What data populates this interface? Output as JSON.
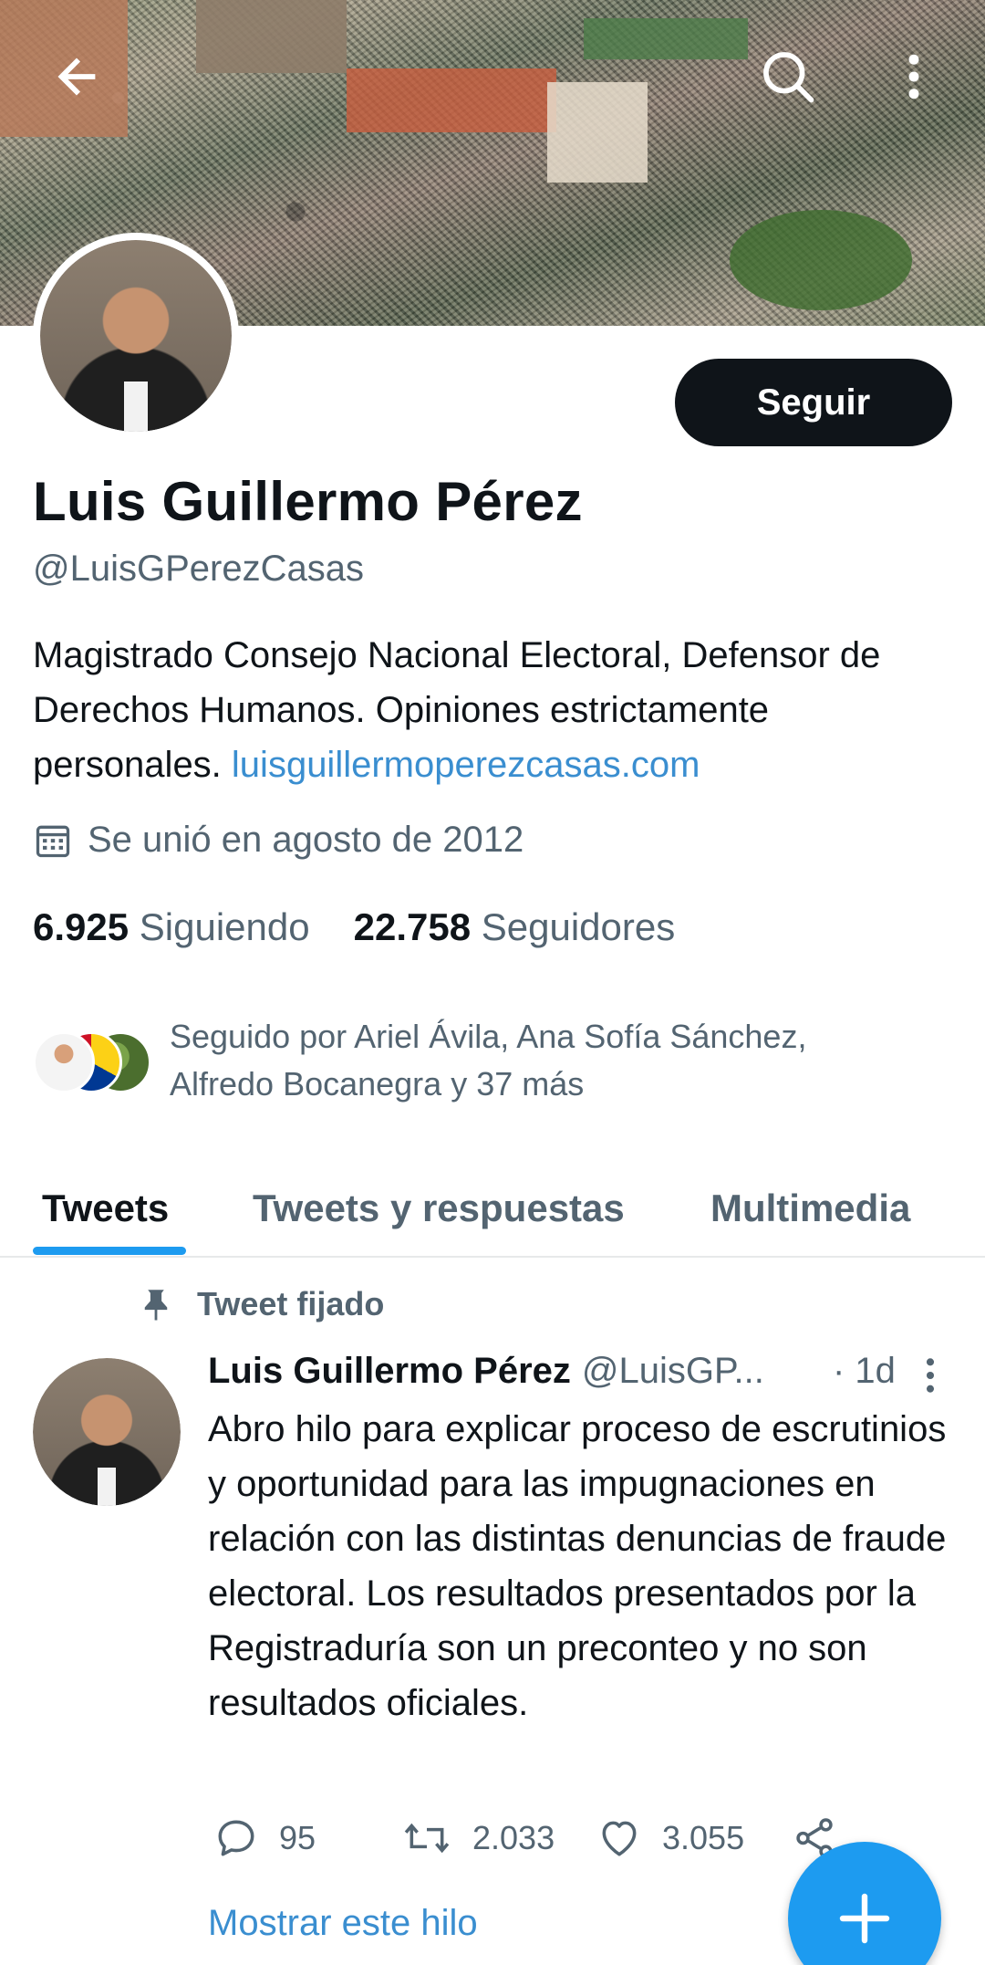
{
  "profile": {
    "name": "Luis Guillermo Pérez",
    "handle": "@LuisGPerezCasas",
    "follow_label": "Seguir",
    "bio_text": "Magistrado Consejo Nacional Electoral, Defensor de Derechos Humanos. Opiniones estrictamente personales. ",
    "bio_link": "luisguillermoperezcasas.com",
    "joined": "Se unió en agosto de 2012",
    "following_count": "6.925",
    "following_label": "Siguiendo",
    "followers_count": "22.758",
    "followers_label": "Seguidores",
    "followed_by": "Seguido por Ariel Ávila, Ana Sofía Sánchez, Alfredo Bocanegra y 37 más"
  },
  "tabs": [
    {
      "label": "Tweets",
      "active": true
    },
    {
      "label": "Tweets y respuestas",
      "active": false
    },
    {
      "label": "Multimedia",
      "active": false
    }
  ],
  "pinned_tweet": {
    "pinned_label": "Tweet fijado",
    "author_name": "Luis Guillermo Pérez",
    "author_handle": "@LuisGP...",
    "time": "· 1d",
    "text": "Abro hilo para explicar proceso de escrutinios y oportunidad para las impugnaciones en relación con las distintas denuncias de fraude electoral. Los resultados presentados por la Registraduría son un preconteo y no son resultados oficiales.",
    "replies": "95",
    "retweets": "2.033",
    "likes": "3.055",
    "show_thread": "Mostrar este hilo"
  },
  "icons": {
    "back": "arrow-left-icon",
    "search": "search-icon",
    "more": "more-vertical-icon",
    "calendar": "calendar-icon",
    "pin": "pin-icon",
    "reply": "reply-icon",
    "retweet": "retweet-icon",
    "like": "heart-icon",
    "share": "share-icon",
    "compose": "plus-icon"
  },
  "colors": {
    "accent": "#1d9bf0",
    "text": "#0f1419",
    "secondary": "#536471",
    "link": "#3a8ed0"
  }
}
